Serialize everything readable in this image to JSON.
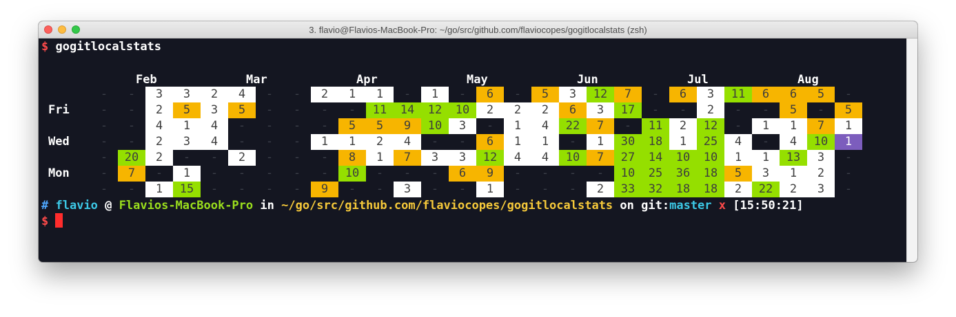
{
  "window": {
    "title": "3. flavio@Flavios-MacBook-Pro: ~/go/src/github.com/flaviocopes/gogitlocalstats (zsh)"
  },
  "prompt1": {
    "dollar": "$",
    "command": "gogitlocalstats"
  },
  "months": [
    "Feb",
    "Mar",
    "Apr",
    "May",
    "Jun",
    "Jul",
    "Aug"
  ],
  "weekdays": [
    "Fri",
    "Wed",
    "Mon"
  ],
  "grid": [
    [
      "-",
      "-",
      "w3",
      "w3",
      "w2",
      "w4",
      "-",
      "-",
      "w2",
      "w1",
      "w1",
      "-",
      "w1",
      "-",
      "y6",
      "-",
      "y5",
      "w3",
      "g12",
      "y7",
      "-",
      "y6",
      "w3",
      "g11",
      "y6",
      "y6",
      "y5",
      "-"
    ],
    [
      "-",
      "-",
      "w2",
      "y5",
      "w3",
      "y5",
      "-",
      "-",
      "-",
      "-",
      "g11",
      "g14",
      "g12",
      "g10",
      "w2",
      "w2",
      "w2",
      "y6",
      "w3",
      "g17",
      "-",
      "-",
      "w2",
      "-",
      "-",
      "y5",
      "-",
      "y5"
    ],
    [
      "-",
      "-",
      "w4",
      "w1",
      "w4",
      "-",
      "-",
      "-",
      "-",
      "y5",
      "y5",
      "y9",
      "g10",
      "w3",
      "-",
      "w1",
      "w4",
      "g22",
      "y7",
      "-",
      "g11",
      "w2",
      "g12",
      "-",
      "w1",
      "w1",
      "y7",
      "w1"
    ],
    [
      "-",
      "-",
      "w2",
      "w3",
      "w4",
      "-",
      "-",
      "-",
      "w1",
      "w1",
      "w2",
      "w4",
      "-",
      "-",
      "y6",
      "w1",
      "w1",
      "-",
      "w1",
      "g30",
      "g18",
      "w1",
      "g25",
      "w4",
      "-",
      "w4",
      "g10",
      "p1"
    ],
    [
      "-",
      "g20",
      "w2",
      "-",
      "-",
      "w2",
      "-",
      "-",
      "-",
      "y8",
      "w1",
      "y7",
      "w3",
      "w3",
      "g12",
      "w4",
      "w4",
      "g10",
      "y7",
      "g27",
      "g14",
      "g10",
      "g10",
      "w1",
      "w1",
      "g13",
      "w3",
      "-"
    ],
    [
      "-",
      "y7",
      "-",
      "w1",
      "-",
      "-",
      "-",
      "-",
      "-",
      "g10",
      "-",
      "-",
      "-",
      "y6",
      "y9",
      "-",
      "-",
      "-",
      "-",
      "g10",
      "g25",
      "g36",
      "g18",
      "y5",
      "w3",
      "w1",
      "w2",
      "-"
    ],
    [
      "-",
      "-",
      "w1",
      "g15",
      "-",
      "-",
      "-",
      "-",
      "y9",
      "-",
      "-",
      "w3",
      "-",
      "-",
      "w1",
      "-",
      "-",
      "-",
      "w2",
      "g33",
      "g32",
      "g18",
      "g18",
      "w2",
      "g22",
      "w2",
      "w3",
      "-"
    ]
  ],
  "prompt2": {
    "hash": "#",
    "user": "flavio",
    "at": "@",
    "host": "Flavios-MacBook-Pro",
    "in": "in",
    "path": "~/go/src/github.com/flaviocopes/gogitlocalstats",
    "on": "on",
    "git_label": "git:",
    "branch": "master",
    "dirty": "x",
    "time": "[15:50:21]"
  },
  "prompt3": {
    "dollar": "$"
  },
  "colors": {
    "background": "#141621",
    "white_cell": "#ffffff",
    "yellow_cell": "#f7b500",
    "green_cell": "#95df00",
    "purple_cell": "#7c5dbd",
    "cursor": "#ff2c2c"
  }
}
